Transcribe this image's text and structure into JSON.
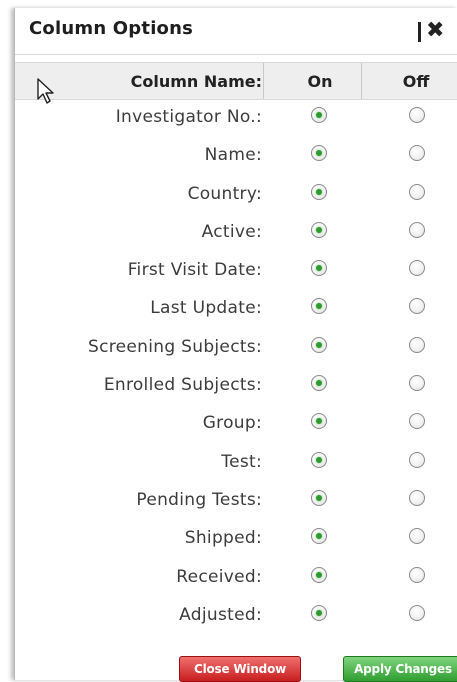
{
  "dialog": {
    "title": "Column Options",
    "close_icon": "close-icon"
  },
  "table": {
    "headers": {
      "name": "Column Name:",
      "on": "On",
      "off": "Off"
    },
    "rows": [
      {
        "label": "Investigator No.:",
        "on": true
      },
      {
        "label": "Name:",
        "on": true
      },
      {
        "label": "Country:",
        "on": true
      },
      {
        "label": "Active:",
        "on": true
      },
      {
        "label": "First Visit Date:",
        "on": true
      },
      {
        "label": "Last Update:",
        "on": true
      },
      {
        "label": "Screening Subjects:",
        "on": true
      },
      {
        "label": "Enrolled Subjects:",
        "on": true
      },
      {
        "label": "Group:",
        "on": true
      },
      {
        "label": "Test:",
        "on": true
      },
      {
        "label": "Pending Tests:",
        "on": true
      },
      {
        "label": "Shipped:",
        "on": true
      },
      {
        "label": "Received:",
        "on": true
      },
      {
        "label": "Adjusted:",
        "on": true
      }
    ]
  },
  "buttons": {
    "close_label": "Close Window",
    "apply_label": "Apply Changes"
  },
  "colors": {
    "selected_radio": "#2f9a2f",
    "close_button": "#c81e1e",
    "apply_button": "#2f9e2f"
  }
}
